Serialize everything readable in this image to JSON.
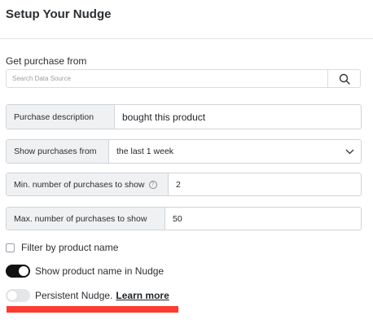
{
  "header": {
    "title": "Setup Your Nudge"
  },
  "source": {
    "label": "Get purchase from",
    "search_placeholder": "Search Data Source",
    "search_icon": "search-icon"
  },
  "fields": {
    "description": {
      "label": "Purchase description",
      "value": "bought this product"
    },
    "period": {
      "label": "Show purchases from",
      "value": "the last 1 week"
    },
    "min": {
      "label": "Min. number of purchases to show",
      "value": "2",
      "icon": "info-icon"
    },
    "max": {
      "label": "Max. number of purchases to show",
      "value": "50"
    }
  },
  "options": {
    "filter": {
      "label": "Filter by product name",
      "checked": false
    },
    "show_name": {
      "label": "Show product name in Nudge",
      "on": true
    },
    "persistent": {
      "label": "Persistent Nudge.",
      "link": "Learn more",
      "on": false
    }
  },
  "colors": {
    "highlight": "#ff3b2f",
    "toggle_on": "#111111"
  }
}
